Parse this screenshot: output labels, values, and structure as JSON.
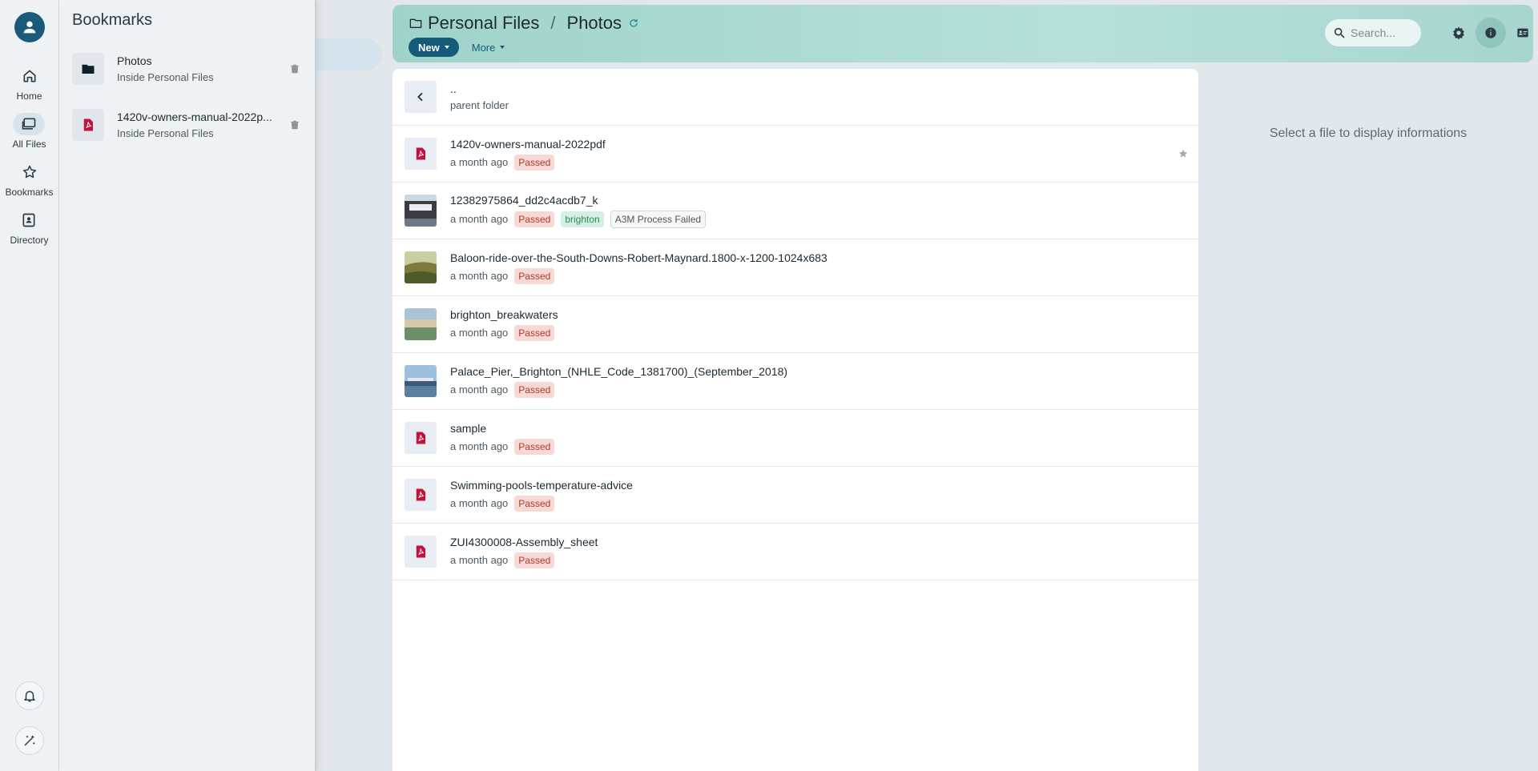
{
  "rail": {
    "items": [
      {
        "label": "Home",
        "icon": "home-icon"
      },
      {
        "label": "All Files",
        "icon": "folders-icon"
      },
      {
        "label": "Bookmarks",
        "icon": "star-outline-icon"
      },
      {
        "label": "Directory",
        "icon": "contact-book-icon"
      }
    ],
    "active": "All Files"
  },
  "bookmarks": {
    "title": "Bookmarks",
    "items": [
      {
        "title": "Photos",
        "subtitle": "Inside Personal Files",
        "icon": "folder-icon"
      },
      {
        "title": "1420v-owners-manual-2022p...",
        "subtitle": "Inside Personal Files",
        "icon": "pdf-icon"
      }
    ]
  },
  "header": {
    "breadcrumb": [
      "Personal Files",
      "Photos"
    ],
    "new_label": "New",
    "more_label": "More",
    "search_placeholder": "Search..."
  },
  "list": {
    "parent": {
      "title": "..",
      "subtitle": "parent folder"
    },
    "files": [
      {
        "name": "1420v-owners-manual-2022pdf",
        "date": "a month ago",
        "tags": [
          "Passed"
        ],
        "type": "pdf",
        "starred": true
      },
      {
        "name": "12382975864_dd2c4acdb7_k",
        "date": "a month ago",
        "tags": [
          "Passed",
          "brighton",
          "A3M Process Failed"
        ],
        "type": "image"
      },
      {
        "name": "Baloon-ride-over-the-South-Downs-Robert-Maynard.1800-x-1200-1024x683",
        "date": "a month ago",
        "tags": [
          "Passed"
        ],
        "type": "image"
      },
      {
        "name": "brighton_breakwaters",
        "date": "a month ago",
        "tags": [
          "Passed"
        ],
        "type": "image"
      },
      {
        "name": "Palace_Pier,_Brighton_(NHLE_Code_1381700)_(September_2018)",
        "date": "a month ago",
        "tags": [
          "Passed"
        ],
        "type": "image"
      },
      {
        "name": "sample",
        "date": "a month ago",
        "tags": [
          "Passed"
        ],
        "type": "pdf"
      },
      {
        "name": "Swimming-pools-temperature-advice",
        "date": "a month ago",
        "tags": [
          "Passed"
        ],
        "type": "pdf"
      },
      {
        "name": "ZUI4300008-Assembly_sheet",
        "date": "a month ago",
        "tags": [
          "Passed"
        ],
        "type": "pdf"
      }
    ]
  },
  "info": {
    "message": "Select a file to display informations"
  },
  "colors": {
    "accent": "#145a79",
    "pdf": "#c0143c",
    "passed_bg": "#f6d8d4",
    "passed_fg": "#b13a2e",
    "header": "#a7d6cf"
  }
}
